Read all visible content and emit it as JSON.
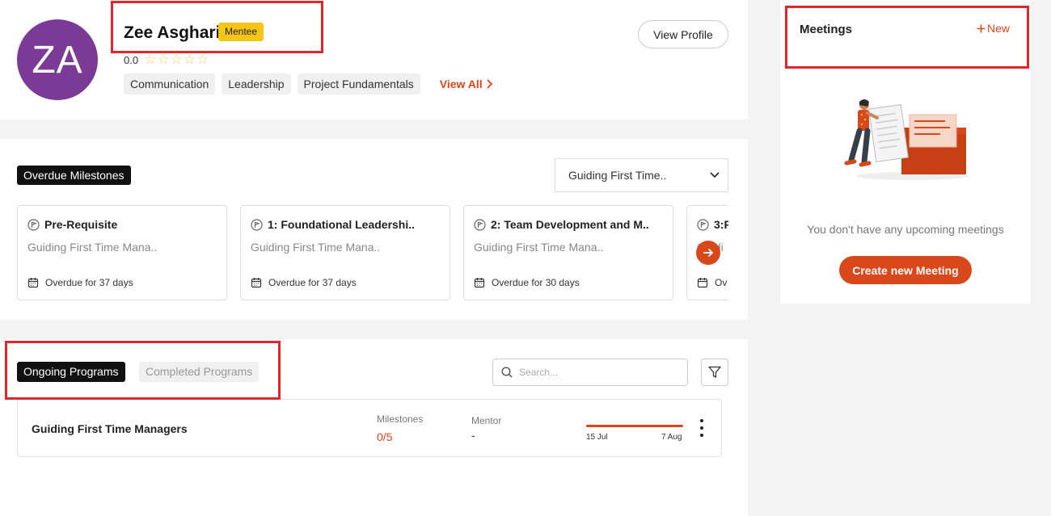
{
  "profile": {
    "avatar_initials": "ZA",
    "name": "Zee Asghari",
    "role_badge": "Mentee",
    "rating_value": "0.0",
    "stars": "☆☆☆☆☆",
    "tags": [
      "Communication",
      "Leadership",
      "Project Fundamentals"
    ],
    "view_all_label": "View All",
    "view_profile_label": "View Profile"
  },
  "milestones": {
    "header": "Overdue Milestones",
    "program_select": "Guiding First Time..",
    "cards": [
      {
        "title": "Pre-Requisite",
        "program": "Guiding First Time Mana..",
        "due": "Overdue for 37 days"
      },
      {
        "title": "1: Foundational Leadershi..",
        "program": "Guiding First Time Mana..",
        "due": "Overdue for 37 days"
      },
      {
        "title": "2: Team Development and M..",
        "program": "Guiding First Time Mana..",
        "due": "Overdue for 30 days"
      },
      {
        "title": "3:P",
        "program": "Guidi",
        "due": "Ov"
      }
    ]
  },
  "programs": {
    "tabs": [
      "Ongoing Programs",
      "Completed Programs"
    ],
    "active_tab": "Ongoing Programs",
    "search_placeholder": "Search...",
    "rows": [
      {
        "name": "Guiding First Time Managers",
        "milestones_label": "Milestones",
        "milestones_value": "0/5",
        "mentor_label": "Mentor",
        "mentor_value": "-",
        "start_date": "15 Jul",
        "end_date": "7 Aug"
      }
    ]
  },
  "meetings": {
    "title": "Meetings",
    "new_label": "New",
    "empty_text": "You don't have any upcoming meetings",
    "create_label": "Create new Meeting"
  },
  "colors": {
    "accent": "#d8481a",
    "avatar_bg": "#7b3a96",
    "badge_yellow": "#f5c518",
    "highlight_red": "#e2262b"
  }
}
